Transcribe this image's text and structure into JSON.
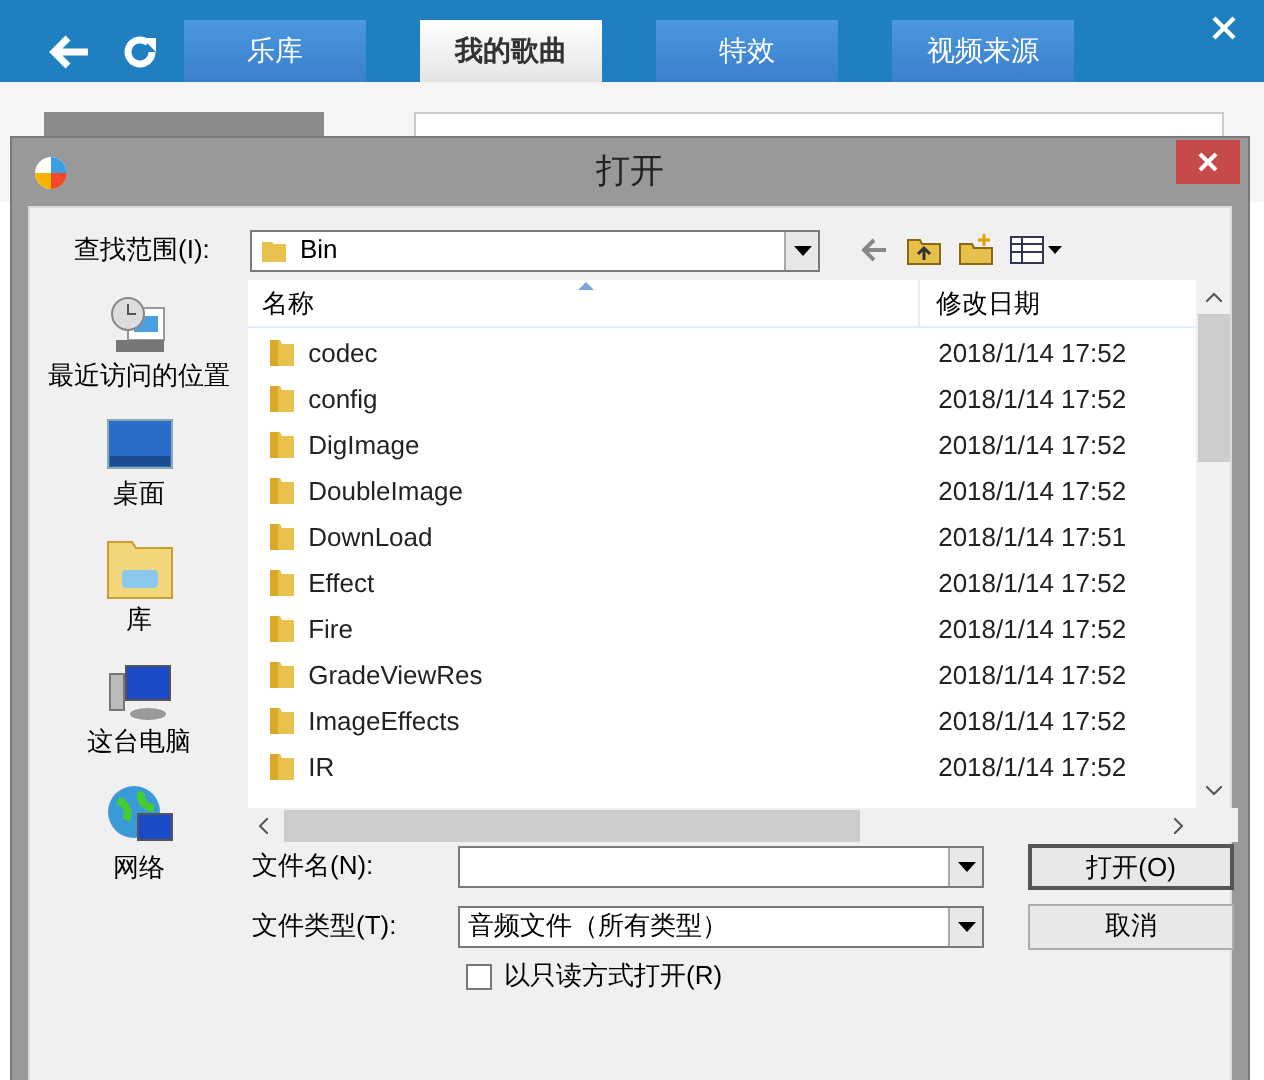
{
  "app": {
    "tabs": [
      {
        "label": "乐库",
        "selected": false
      },
      {
        "label": "我的歌曲",
        "selected": true
      },
      {
        "label": "特效",
        "selected": false
      },
      {
        "label": "视频来源",
        "selected": false
      }
    ]
  },
  "dialog": {
    "title": "打开",
    "look_in": {
      "label": "查找范围(I):",
      "value": "Bin"
    },
    "places": [
      {
        "kind": "recent",
        "label": "最近访问的位置"
      },
      {
        "kind": "desktop",
        "label": "桌面"
      },
      {
        "kind": "library",
        "label": "库"
      },
      {
        "kind": "computer",
        "label": "这台电脑"
      },
      {
        "kind": "network",
        "label": "网络"
      }
    ],
    "columns": [
      "名称",
      "修改日期"
    ],
    "files": [
      {
        "name": "codec",
        "modified": "2018/1/14 17:52"
      },
      {
        "name": "config",
        "modified": "2018/1/14 17:52"
      },
      {
        "name": "DigImage",
        "modified": "2018/1/14 17:52"
      },
      {
        "name": "DoubleImage",
        "modified": "2018/1/14 17:52"
      },
      {
        "name": "DownLoad",
        "modified": "2018/1/14 17:51"
      },
      {
        "name": "Effect",
        "modified": "2018/1/14 17:52"
      },
      {
        "name": "Fire",
        "modified": "2018/1/14 17:52"
      },
      {
        "name": "GradeViewRes",
        "modified": "2018/1/14 17:52"
      },
      {
        "name": "ImageEffects",
        "modified": "2018/1/14 17:52"
      },
      {
        "name": "IR",
        "modified": "2018/1/14 17:52"
      }
    ],
    "file_name": {
      "label": "文件名(N):"
    },
    "file_type": {
      "label": "文件类型(T):",
      "value": "音频文件（所有类型）"
    },
    "read_only": {
      "label": "以只读方式打开(R)",
      "checked": false
    },
    "buttons": [
      {
        "label": "打开(O)",
        "default": true
      },
      {
        "label": "取消",
        "default": false
      }
    ]
  }
}
